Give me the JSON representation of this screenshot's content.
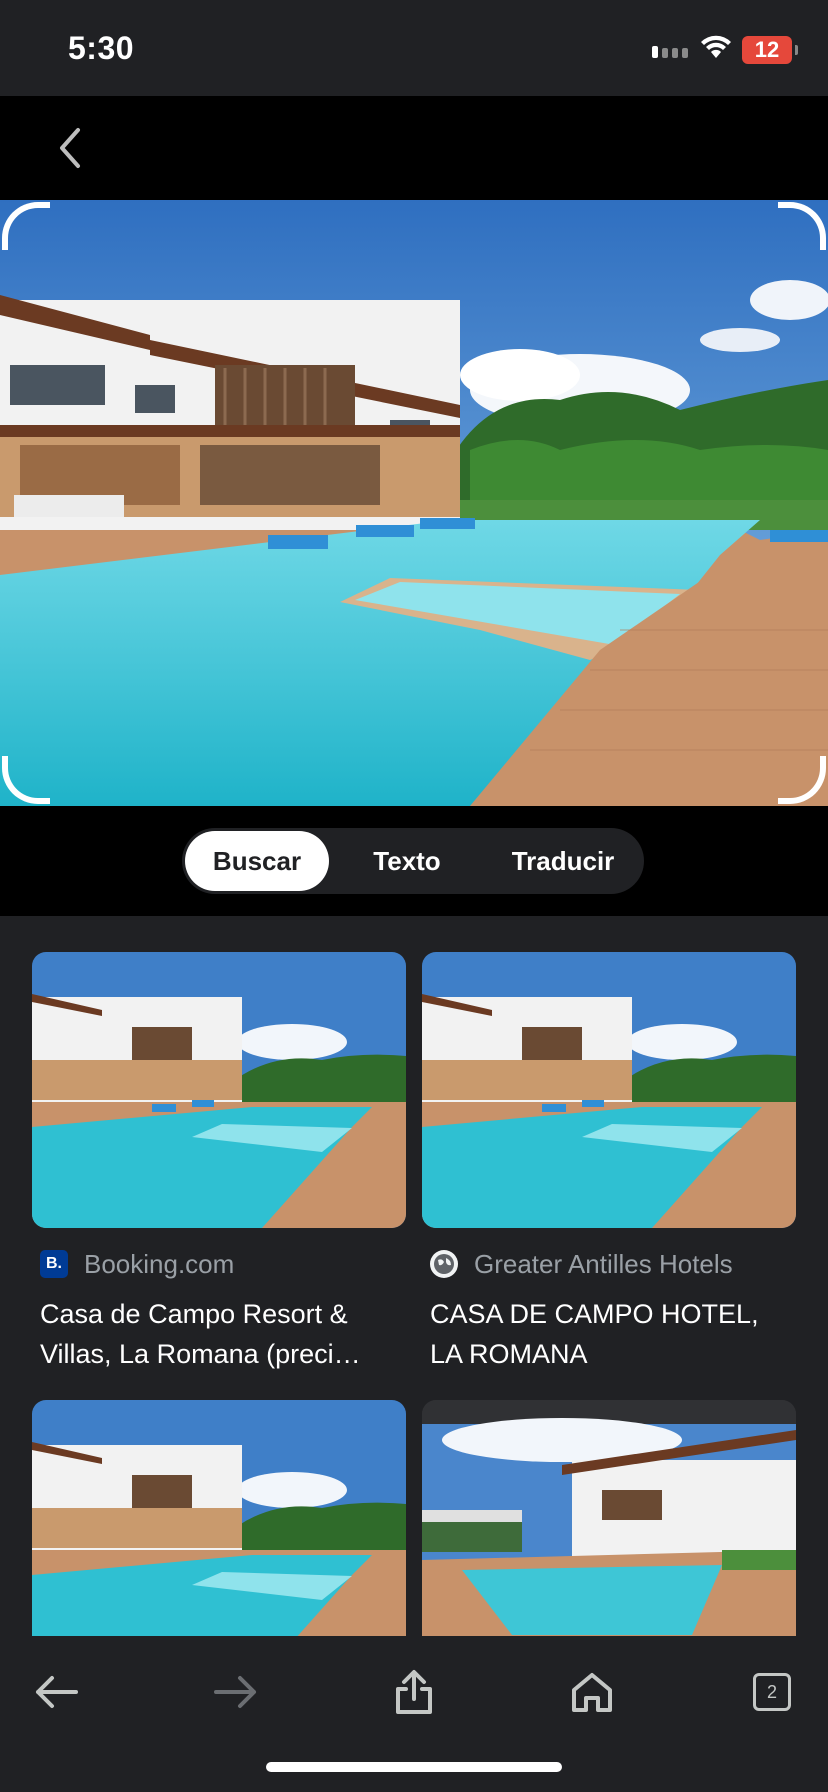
{
  "status_bar": {
    "time": "5:30",
    "battery": "12"
  },
  "mode_tabs": [
    {
      "label": "Buscar",
      "active": true
    },
    {
      "label": "Texto",
      "active": false
    },
    {
      "label": "Traducir",
      "active": false
    }
  ],
  "results": [
    {
      "source_icon_text": "B.",
      "source": "Booking.com",
      "title": "Casa de Campo Resort & Villas, La Romana (preci…"
    },
    {
      "source_icon": "globe-icon",
      "source": "Greater Antilles Hotels",
      "title": "CASA DE CAMPO HOTEL, LA ROMANA"
    }
  ],
  "toolbar": {
    "tabs_count": "2"
  },
  "colors": {
    "background": "#202124",
    "booking": "#003b95",
    "sky": "#3f7fc8",
    "pool": "#3ec6d6"
  }
}
